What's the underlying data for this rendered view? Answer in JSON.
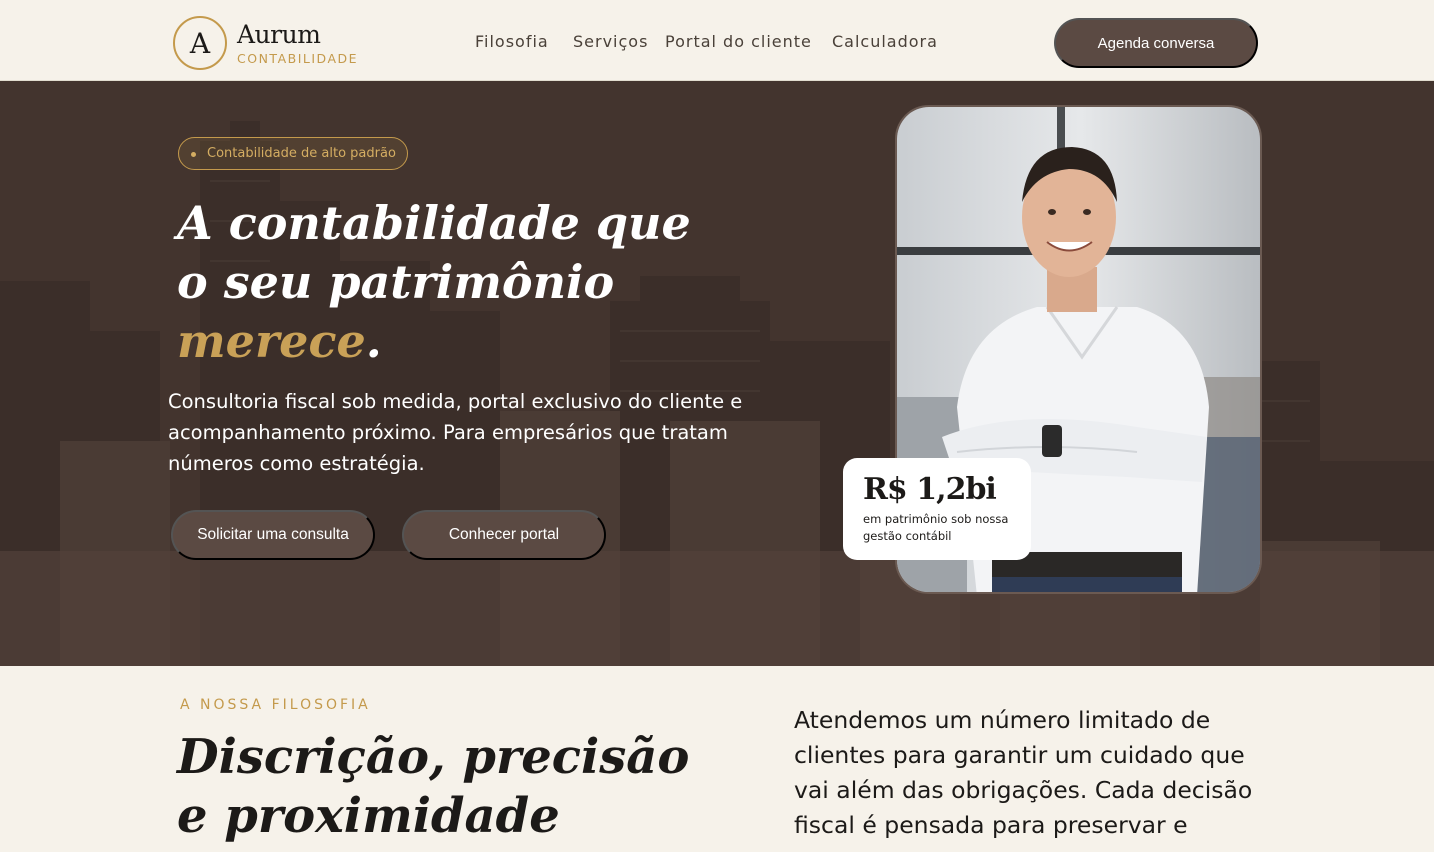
{
  "header": {
    "logo_letter": "A",
    "brand_name": "Aurum",
    "brand_sub": "CONTABILIDADE",
    "nav": [
      "Filosofia",
      "Serviços",
      "Portal do cliente",
      "Calculadora"
    ],
    "cta": "Agenda conversa"
  },
  "hero": {
    "badge": "Contabilidade de alto padrão",
    "title_line1": "A contabilidade que",
    "title_line2": "o seu patrimônio",
    "title_highlight": "merece",
    "title_end": ".",
    "description": "Consultoria fiscal sob medida, portal exclusivo do cliente e acompanhamento próximo. Para empresários que tratam números como estratégia.",
    "primary_button": "Solicitar uma consulta",
    "secondary_button": "Conhecer portal",
    "stat_value": "R$ 1,2bi",
    "stat_label": "em patrimônio sob nossa gestão contábil"
  },
  "philosophy": {
    "eyebrow": "A NOSSA FILOSOFIA",
    "title_line1": "Discrição, precisão",
    "title_line2": "e proximidade",
    "text": "Atendemos um número limitado de clientes para garantir um cuidado que vai além das obrigações. Cada decisão fiscal é pensada para preservar e"
  },
  "colors": {
    "accent": "#c49a4c",
    "primary_button": "#5b4a43",
    "hero_bg": "#43342e",
    "page_bg": "#f6f2ea"
  }
}
